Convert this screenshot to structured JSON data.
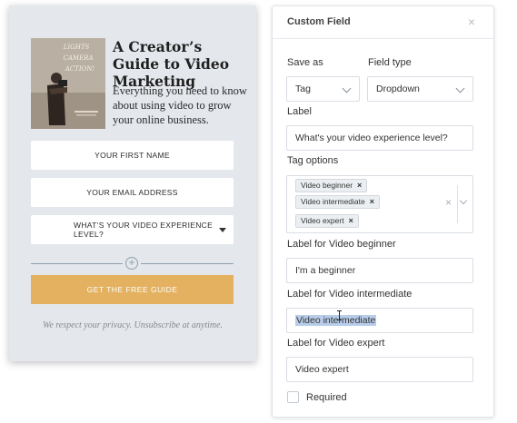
{
  "form_preview": {
    "title": "A Creator’s Guide to Video Marketing",
    "subtitle": "Everything you need to know about using video to grow your online business.",
    "cover_text": "LIGHTS CAMERA ACTION!",
    "fields": {
      "first_name": "YOUR FIRST NAME",
      "email": "YOUR EMAIL ADDRESS",
      "experience": "WHAT’S YOUR VIDEO EXPERIENCE LEVEL?"
    },
    "add_field_symbol": "+",
    "submit_label": "GET THE FREE GUIDE",
    "privacy_note": "We respect your privacy. Unsubscribe at anytime.",
    "button_color": "#e3b15f"
  },
  "panel": {
    "title": "Custom Field",
    "close_symbol": "×",
    "save_as_label": "Save as",
    "save_as_value": "Tag",
    "field_type_label": "Field type",
    "field_type_value": "Dropdown",
    "label_label": "Label",
    "label_value": "What's your video experience level?",
    "tag_options_label": "Tag options",
    "tags": [
      "Video beginner",
      "Video intermediate",
      "Video expert"
    ],
    "tag_remove_symbol": "×",
    "clear_symbol": "×",
    "label_for": [
      {
        "label": "Label for Video beginner",
        "value": "I'm a beginner"
      },
      {
        "label": "Label for Video intermediate",
        "value": "Video intermediate"
      },
      {
        "label": "Label for Video expert",
        "value": "Video expert"
      }
    ],
    "required_label": "Required",
    "selection_color": "#b8cdea"
  }
}
